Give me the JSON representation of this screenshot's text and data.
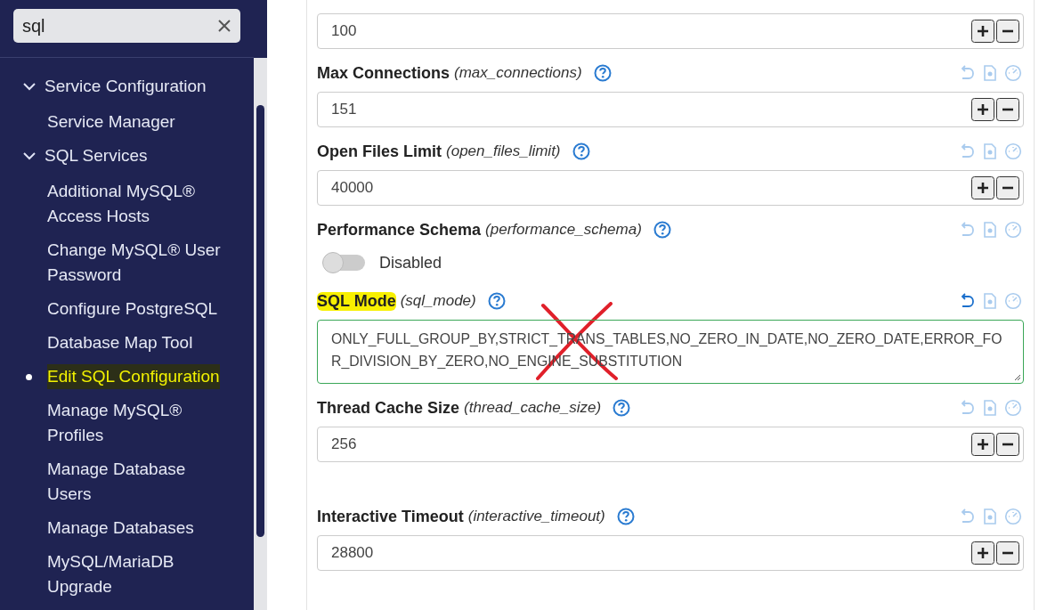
{
  "sidebar": {
    "search": {
      "value": "sql"
    },
    "items": [
      {
        "label": "Service Configuration",
        "expanded": true,
        "children": [
          {
            "label": "Service Manager",
            "selected": false,
            "highlighted": false
          }
        ]
      },
      {
        "label": "SQL Services",
        "expanded": true,
        "children": [
          {
            "label": "Additional MySQL® Access Hosts",
            "selected": false,
            "highlighted": false
          },
          {
            "label": "Change MySQL® User Password",
            "selected": false,
            "highlighted": false
          },
          {
            "label": "Configure PostgreSQL",
            "selected": false,
            "highlighted": false
          },
          {
            "label": "Database Map Tool",
            "selected": false,
            "highlighted": false
          },
          {
            "label": "Edit SQL Configuration",
            "selected": true,
            "highlighted": true
          },
          {
            "label": "Manage MySQL® Profiles",
            "selected": false,
            "highlighted": false
          },
          {
            "label": "Manage Database Users",
            "selected": false,
            "highlighted": false
          },
          {
            "label": "Manage Databases",
            "selected": false,
            "highlighted": false
          },
          {
            "label": "MySQL/MariaDB Upgrade",
            "selected": false,
            "highlighted": false
          }
        ]
      }
    ]
  },
  "settings": [
    {
      "kind": "number",
      "value": "100"
    },
    {
      "kind": "number",
      "label": "Max Connections",
      "key": "(max_connections)",
      "value": "151",
      "modified": false,
      "highlighted": false
    },
    {
      "kind": "number",
      "label": "Open Files Limit",
      "key": "(open_files_limit)",
      "value": "40000",
      "modified": false,
      "highlighted": false
    },
    {
      "kind": "toggle",
      "label": "Performance Schema",
      "key": "(performance_schema)",
      "on": false,
      "state_label": "Disabled",
      "modified": false,
      "highlighted": false
    },
    {
      "kind": "textarea",
      "label": "SQL Mode",
      "key": "(sql_mode)",
      "value": "ONLY_FULL_GROUP_BY,STRICT_TRANS_TABLES,NO_ZERO_IN_DATE,NO_ZERO_DATE,ERROR_FOR_DIVISION_BY_ZERO,NO_ENGINE_SUBSTITUTION",
      "modified": true,
      "highlighted": true,
      "crossed_out": true
    },
    {
      "kind": "number",
      "label": "Thread Cache Size",
      "key": "(thread_cache_size)",
      "value": "256",
      "modified": false,
      "highlighted": false
    },
    {
      "kind": "number",
      "label": "Interactive Timeout",
      "key": "(interactive_timeout)",
      "value": "28800",
      "modified": false,
      "highlighted": false,
      "spaced": true
    }
  ]
}
